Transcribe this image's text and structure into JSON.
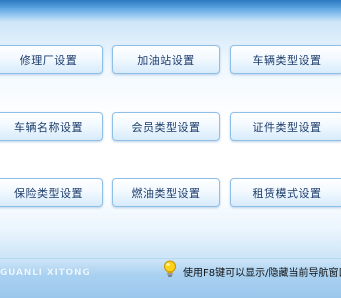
{
  "buttons": [
    {
      "label": "修理厂设置"
    },
    {
      "label": "加油站设置"
    },
    {
      "label": "车辆类型设置"
    },
    {
      "label": "车辆名称设置"
    },
    {
      "label": "会员类型设置"
    },
    {
      "label": "证件类型设置"
    },
    {
      "label": "保险类型设置"
    },
    {
      "label": "燃油类型设置"
    },
    {
      "label": "租赁模式设置"
    }
  ],
  "footer": {
    "brand": "GUANLI XITONG",
    "tip": "使用F8键可以显示/隐藏当前导航窗口",
    "tip_icon": "lightbulb-icon"
  },
  "colors": {
    "accent": "#3f8fd2",
    "button_text": "#1d3c6b"
  }
}
